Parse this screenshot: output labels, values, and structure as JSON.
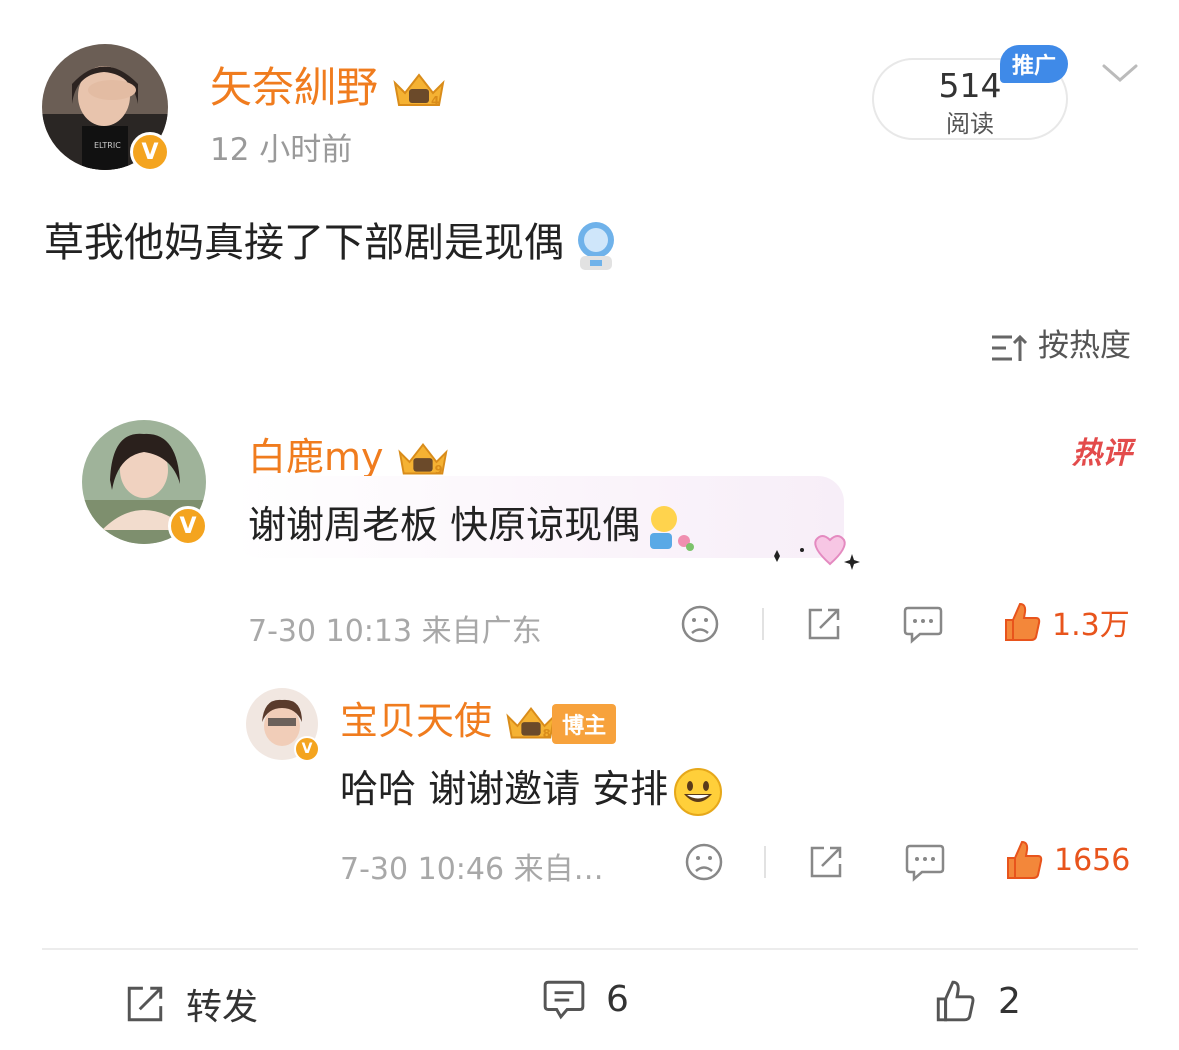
{
  "post": {
    "author": "矢奈紃野",
    "time": "12 小时前",
    "views": "514",
    "views_label": "阅读",
    "promo_label": "推广",
    "text": "草我他妈真接了下部剧是现偶"
  },
  "comments_header": {
    "sort_label": "按热度"
  },
  "comments": [
    {
      "author": "白鹿my",
      "hot_tag": "热评",
      "text": "谢谢周老板 快原谅现偶",
      "meta": "7-30 10:13  来自广东",
      "likes": "1.3万",
      "reply": {
        "author": "宝贝天使",
        "author_tag": "博主",
        "text": "哈哈 谢谢邀请 安排",
        "meta": "7-30 10:46  来自…",
        "likes": "1656"
      }
    }
  ],
  "bottom_bar": {
    "repost_label": "转发",
    "comment_count": "6",
    "like_count": "2"
  },
  "colors": {
    "accent_orange": "#f07c1e",
    "like_orange": "#e8541c",
    "promo_blue": "#3f8ae8",
    "hot_red": "#e34b4b",
    "gray_text": "#9a9a9a"
  }
}
